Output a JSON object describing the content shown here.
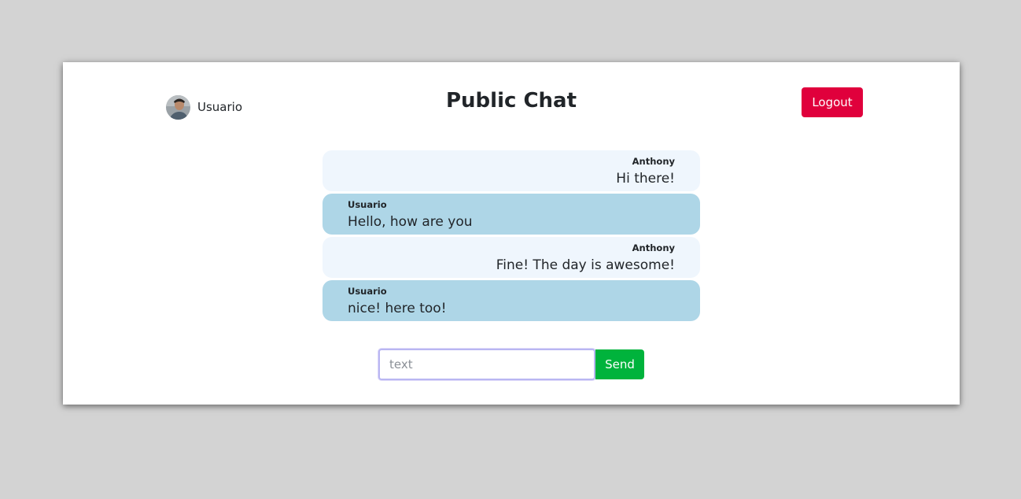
{
  "header": {
    "username": "Usuario",
    "title": "Public Chat",
    "logout_label": "Logout"
  },
  "messages": [
    {
      "sender": "Anthony",
      "text": "Hi there!",
      "side": "other"
    },
    {
      "sender": "Usuario",
      "text": "Hello, how are you",
      "side": "mine"
    },
    {
      "sender": "Anthony",
      "text": "Fine! The day is awesome!",
      "side": "other"
    },
    {
      "sender": "Usuario",
      "text": "nice! here too!",
      "side": "mine"
    }
  ],
  "composer": {
    "value": "",
    "placeholder": "text",
    "send_label": "Send"
  },
  "colors": {
    "page_background": "#d3d3d3",
    "logout": "#e0003c",
    "send": "#00b33c",
    "bubble_other": "#eff6fd",
    "bubble_mine": "#aed6e7"
  }
}
